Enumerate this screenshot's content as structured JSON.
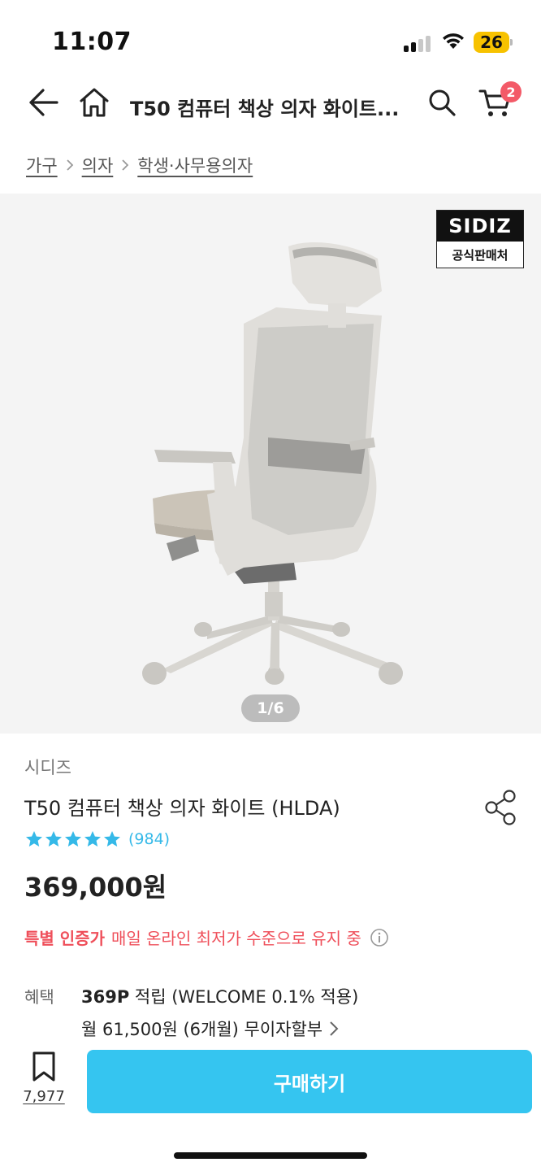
{
  "status_bar": {
    "time": "11:07",
    "battery": "26"
  },
  "header": {
    "title": "T50 컴퓨터 책상 의자 화이트...",
    "cart_count": "2"
  },
  "breadcrumb": [
    "가구",
    "의자",
    "학생·사무용의자"
  ],
  "gallery": {
    "brand_badge_top": "SIDIZ",
    "brand_badge_bottom": "공식판매처",
    "pager": "1/6"
  },
  "product": {
    "brand": "시디즈",
    "title": "T50 컴퓨터 책상 의자 화이트 (HLDA)",
    "rating_stars": 5,
    "review_count": "(984)",
    "price": "369,000원",
    "promo_strong": "특별 인증가",
    "promo_text": "매일 온라인 최저가 수준으로 유지 중"
  },
  "benefit": {
    "label": "혜택",
    "points": "369P",
    "points_text": " 적립 (WELCOME 0.1% 적용)",
    "installment": "월 61,500원 (6개월) 무이자할부"
  },
  "bottom_bar": {
    "bookmark_count": "7,977",
    "buy_label": "구매하기"
  },
  "colors": {
    "accent": "#35c5f0",
    "star": "#35b9e8",
    "promo": "#ef4f5a",
    "badge": "#f35a68"
  }
}
